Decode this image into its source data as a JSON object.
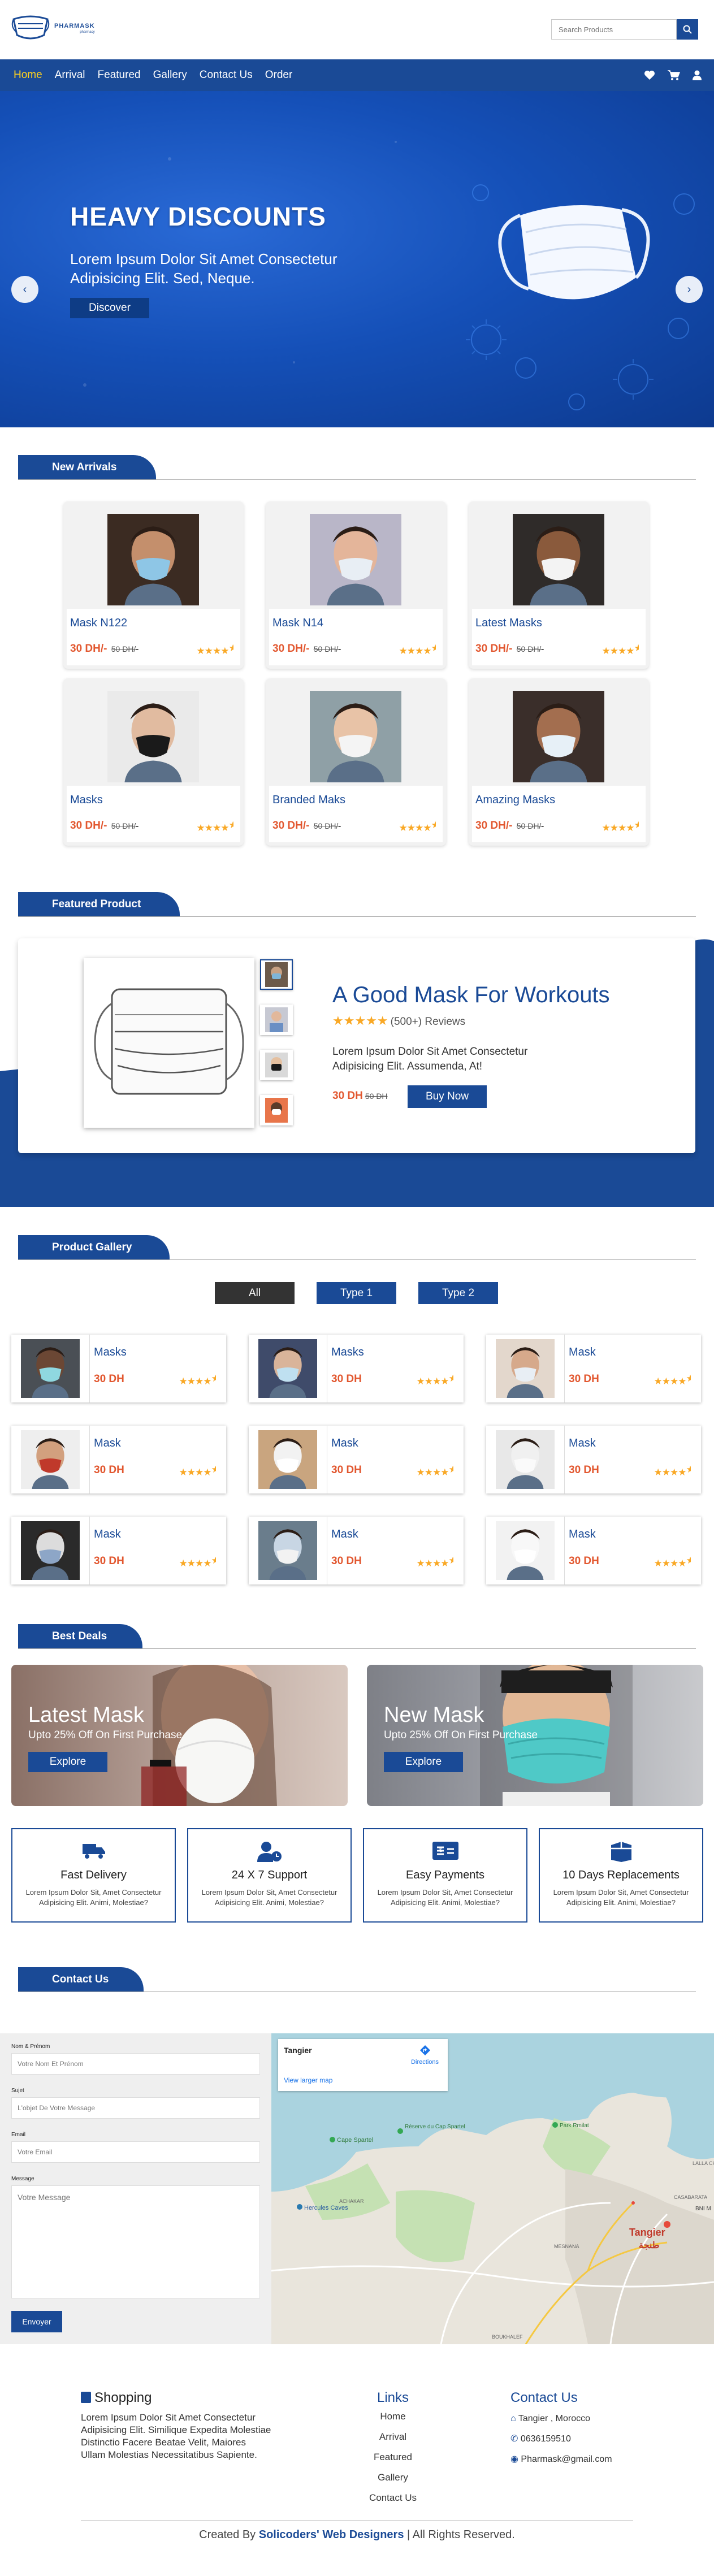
{
  "brand": {
    "name": "PHARMASK",
    "tagline": "pharmacy"
  },
  "search": {
    "placeholder": "Search Products"
  },
  "nav": {
    "items": [
      {
        "label": "Home"
      },
      {
        "label": "Arrival"
      },
      {
        "label": "Featured"
      },
      {
        "label": "Gallery"
      },
      {
        "label": "Contact Us"
      },
      {
        "label": "Order"
      }
    ],
    "icons": [
      "heart-icon",
      "cart-icon",
      "user-icon"
    ]
  },
  "hero": {
    "title": "HEAVY DISCOUNTS",
    "subtitle": "Lorem Ipsum Dolor Sit Amet Consectetur Adipisicing Elit. Sed, Neque.",
    "button": "Discover"
  },
  "arrivals": {
    "heading": "New Arrivals",
    "items": [
      {
        "name": "Mask N122",
        "price": "30 DH/-",
        "old": "50 DH/-",
        "rating": 4.5
      },
      {
        "name": "Mask N14",
        "price": "30 DH/-",
        "old": "50 DH/-",
        "rating": 4.5
      },
      {
        "name": "Latest Masks",
        "price": "30 DH/-",
        "old": "50 DH/-",
        "rating": 4.5
      },
      {
        "name": "Masks",
        "price": "30 DH/-",
        "old": "50 DH/-",
        "rating": 4.5
      },
      {
        "name": "Branded Maks",
        "price": "30 DH/-",
        "old": "50 DH/-",
        "rating": 4.5
      },
      {
        "name": "Amazing Masks",
        "price": "30 DH/-",
        "old": "50 DH/-",
        "rating": 4.5
      }
    ]
  },
  "featured": {
    "heading": "Featured Product",
    "title": "A Good Mask For Workouts",
    "reviews": "(500+) Reviews",
    "description": "Lorem Ipsum Dolor Sit Amet Consectetur Adipisicing Elit. Assumenda, At!",
    "price": "30 DH",
    "old": "50 DH",
    "button": "Buy Now"
  },
  "gallery": {
    "heading": "Product Gallery",
    "filters": [
      {
        "label": "All"
      },
      {
        "label": "Type 1"
      },
      {
        "label": "Type 2"
      }
    ],
    "items": [
      {
        "name": "Masks",
        "price": "30 DH"
      },
      {
        "name": "Masks",
        "price": "30 DH"
      },
      {
        "name": "Mask",
        "price": "30 DH"
      },
      {
        "name": "Mask",
        "price": "30 DH"
      },
      {
        "name": "Mask",
        "price": "30 DH"
      },
      {
        "name": "Mask",
        "price": "30 DH"
      },
      {
        "name": "Mask",
        "price": "30 DH"
      },
      {
        "name": "Mask",
        "price": "30 DH"
      },
      {
        "name": "Mask",
        "price": "30 DH"
      }
    ]
  },
  "deals": {
    "heading": "Best Deals",
    "cards": [
      {
        "title": "Latest Mask",
        "text": "Upto 25% Off On First Purchase",
        "button": "Explore"
      },
      {
        "title": "New Mask",
        "text": "Upto 25% Off On First Purchase",
        "button": "Explore"
      }
    ],
    "features": [
      {
        "title": "Fast Delivery",
        "text": "Lorem Ipsum Dolor Sit, Amet Consectetur Adipisicing Elit. Animi, Molestiae?"
      },
      {
        "title": "24 X 7 Support",
        "text": "Lorem Ipsum Dolor Sit, Amet Consectetur Adipisicing Elit. Animi, Molestiae?"
      },
      {
        "title": "Easy Payments",
        "text": "Lorem Ipsum Dolor Sit, Amet Consectetur Adipisicing Elit. Animi, Molestiae?"
      },
      {
        "title": "10 Days Replacements",
        "text": "Lorem Ipsum Dolor Sit, Amet Consectetur Adipisicing Elit. Animi, Molestiae?"
      }
    ]
  },
  "contact": {
    "heading": "Contact Us",
    "fields": [
      {
        "label": "Nom & Prénom",
        "placeholder": "Votre Nom Et Prénom"
      },
      {
        "label": "Sujet",
        "placeholder": "L'objet De Votre Message"
      },
      {
        "label": "Email",
        "placeholder": "Votre Email"
      },
      {
        "label": "Message",
        "placeholder": "Votre Message"
      }
    ],
    "submit": "Envoyer",
    "map": {
      "place": "Tangier",
      "directions": "Directions",
      "larger": "View larger map",
      "labels": {
        "city": "Tangier",
        "city_ar": "طنجة",
        "cape": "Cape Spartel",
        "reserve": "Réserve du Cap Spartel",
        "caves": "Hercules Caves",
        "park": "Park Rmilat",
        "achakar": "ACHAKAR",
        "mesnana": "MESNANA",
        "boukhalef": "BOUKHALEF",
        "casabarata": "CASABARATA",
        "bnim": "BNI M",
        "lalla": "LALLA CH"
      }
    }
  },
  "footer": {
    "shopping": {
      "title": "Shopping",
      "text": "Lorem Ipsum Dolor Sit Amet Consectetur Adipisicing Elit. Similique Expedita Molestiae Distinctio Facere Beatae Velit, Maiores Ullam Molestias Necessitatibus Sapiente."
    },
    "links": {
      "title": "Links",
      "items": [
        {
          "label": "Home"
        },
        {
          "label": "Arrival"
        },
        {
          "label": "Featured"
        },
        {
          "label": "Gallery"
        },
        {
          "label": "Contact Us"
        }
      ]
    },
    "contact": {
      "title": "Contact Us",
      "address": "Tangier , Morocco",
      "phone": "0636159510",
      "email": "Pharmask@gmail.com"
    },
    "copyright_pre": "Created By",
    "copyright_brand": "Solicoders' Web Designers",
    "copyright_post": "| All Rights Reserved."
  },
  "colors": {
    "primary": "#1a4a96",
    "price": "#e2572f",
    "star": "#f9a825",
    "nav_active": "#ffd21f"
  }
}
